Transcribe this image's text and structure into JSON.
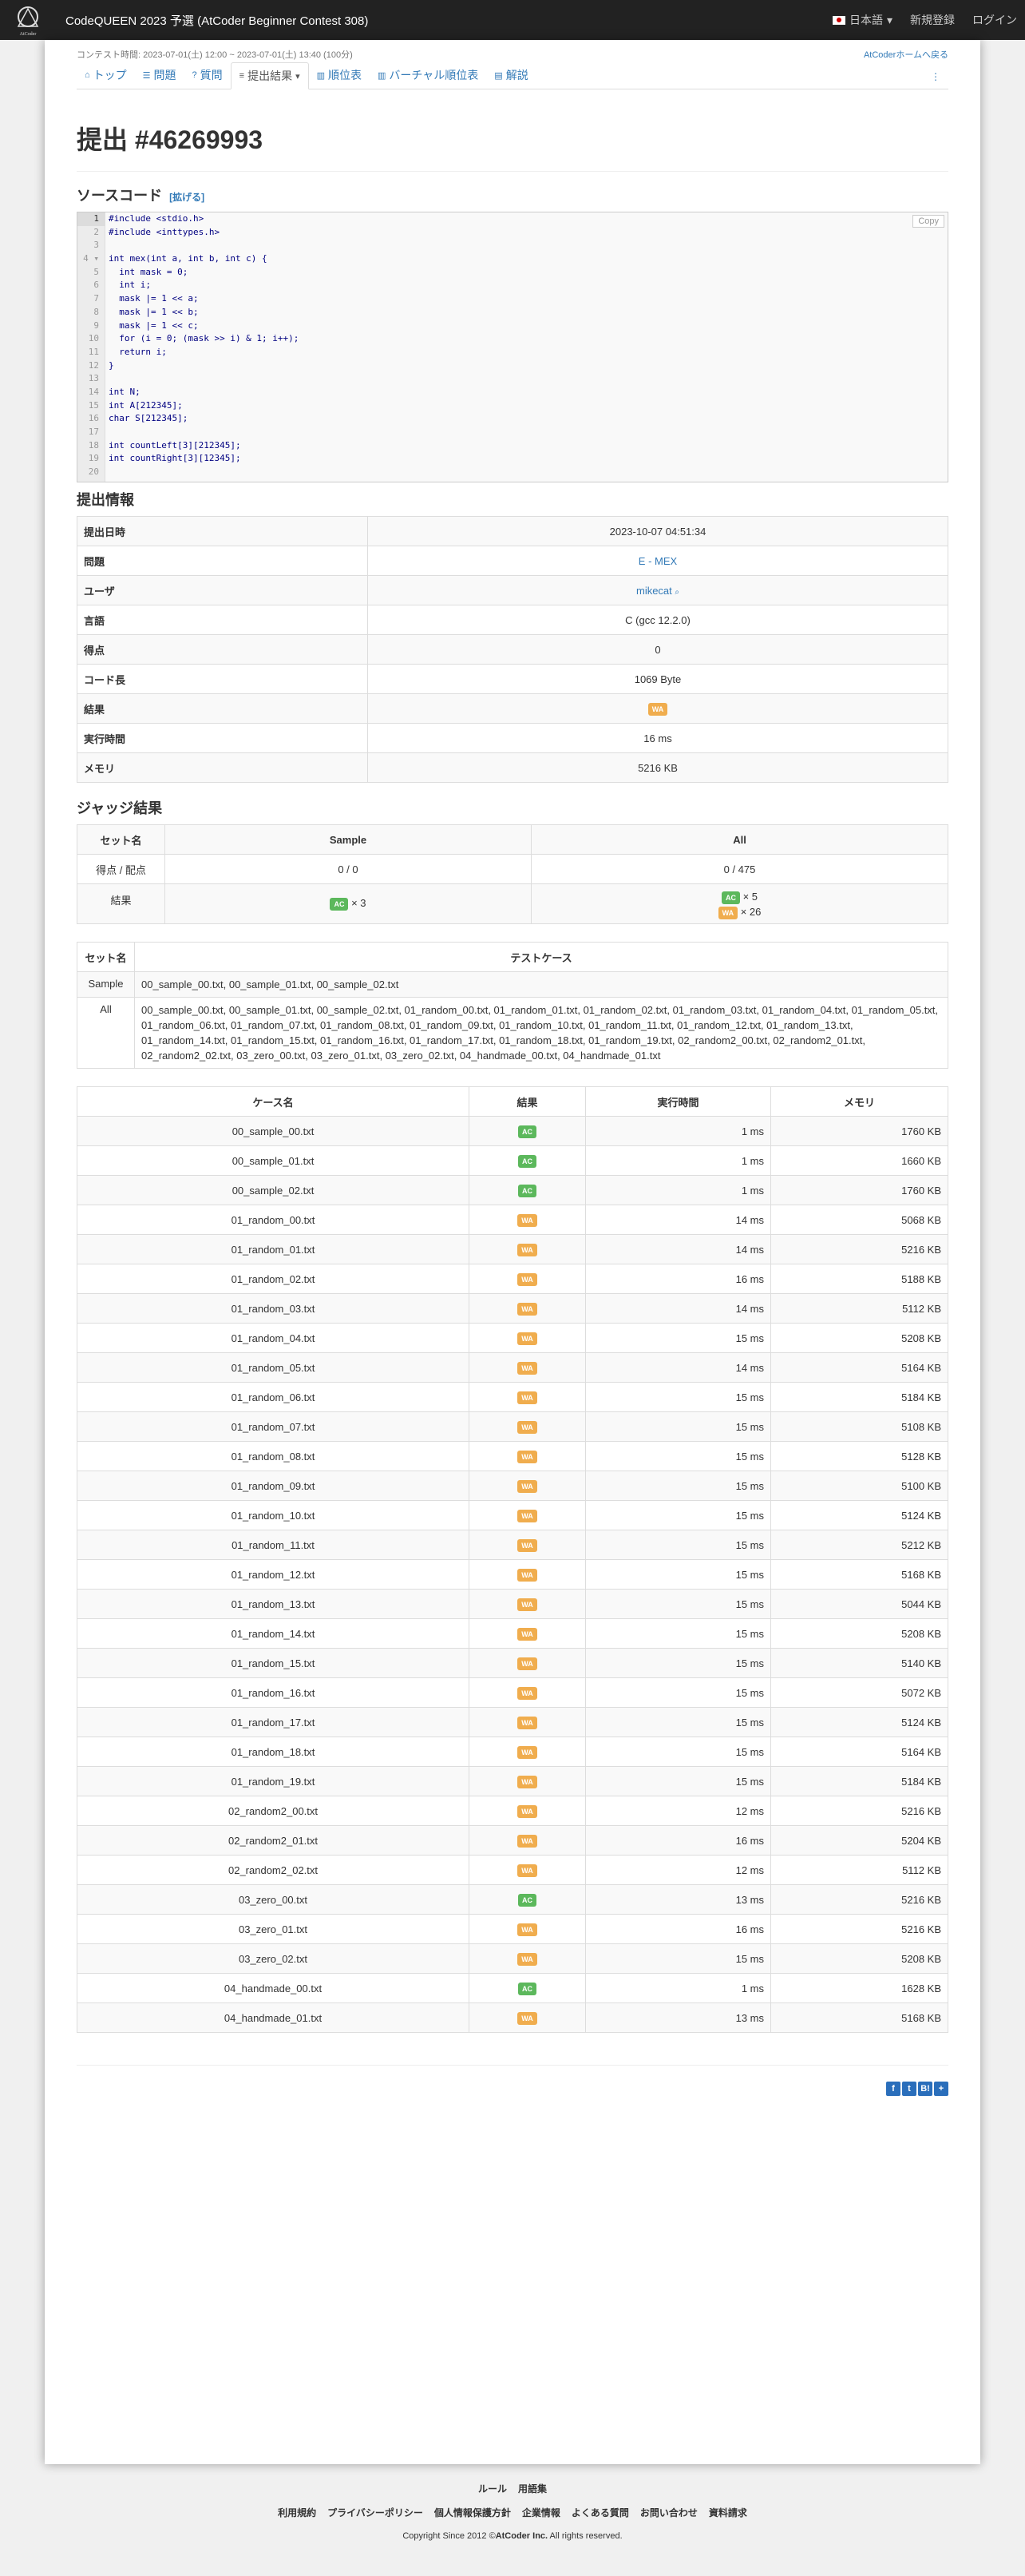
{
  "navbar": {
    "title": "CodeQUEEN 2023 予選 (AtCoder Beginner Contest 308)",
    "lang": "日本語",
    "signup": "新規登録",
    "login": "ログイン",
    "logo_text": "AtCoder"
  },
  "contest_bar": {
    "time": "コンテスト時間: 2023-07-01(土) 12:00 ~ 2023-07-01(土) 13:40 (100分)",
    "home_link": "AtCoderホームへ戻る"
  },
  "tabs": [
    {
      "label": "トップ"
    },
    {
      "label": "問題"
    },
    {
      "label": "質問"
    },
    {
      "label": "提出結果"
    },
    {
      "label": "順位表"
    },
    {
      "label": "バーチャル順位表"
    },
    {
      "label": "解説"
    }
  ],
  "submission": {
    "title": "提出 #46269993"
  },
  "source": {
    "heading": "ソースコード",
    "expand": "[拡げる]",
    "copy": "Copy",
    "lines": [
      "#include <stdio.h>",
      "#include <inttypes.h>",
      "",
      "int mex(int a, int b, int c) {",
      "  int mask = 0;",
      "  int i;",
      "  mask |= 1 << a;",
      "  mask |= 1 << b;",
      "  mask |= 1 << c;",
      "  for (i = 0; (mask >> i) & 1; i++);",
      "  return i;",
      "}",
      "",
      "int N;",
      "int A[212345];",
      "char S[212345];",
      "",
      "int countLeft[3][212345];",
      "int countRight[3][12345];",
      ""
    ]
  },
  "info": {
    "heading": "提出情報",
    "rows": [
      {
        "label": "提出日時",
        "value": "2023-10-07 04:51:34"
      },
      {
        "label": "問題",
        "value": "E - MEX"
      },
      {
        "label": "ユーザ",
        "value": "mikecat"
      },
      {
        "label": "言語",
        "value": "C (gcc 12.2.0)"
      },
      {
        "label": "得点",
        "value": "0"
      },
      {
        "label": "コード長",
        "value": "1069 Byte"
      },
      {
        "label": "結果",
        "value": "WA"
      },
      {
        "label": "実行時間",
        "value": "16 ms"
      },
      {
        "label": "メモリ",
        "value": "5216 KB"
      }
    ]
  },
  "judge": {
    "heading": "ジャッジ結果",
    "headers": [
      "セット名",
      "Sample",
      "All"
    ],
    "score_label": "得点 / 配点",
    "sample_score": "0 / 0",
    "all_score": "0 / 475",
    "result_label": "結果",
    "sample_ac": "AC",
    "sample_ac_count": "× 3",
    "all_ac": "AC",
    "all_ac_count": "× 5",
    "all_wa": "WA",
    "all_wa_count": "× 26"
  },
  "case_sets": {
    "headers": [
      "セット名",
      "テストケース"
    ],
    "rows": [
      {
        "name": "Sample",
        "cases": "00_sample_00.txt, 00_sample_01.txt, 00_sample_02.txt"
      },
      {
        "name": "All",
        "cases": "00_sample_00.txt, 00_sample_01.txt, 00_sample_02.txt, 01_random_00.txt, 01_random_01.txt, 01_random_02.txt, 01_random_03.txt, 01_random_04.txt, 01_random_05.txt, 01_random_06.txt, 01_random_07.txt, 01_random_08.txt, 01_random_09.txt, 01_random_10.txt, 01_random_11.txt, 01_random_12.txt, 01_random_13.txt, 01_random_14.txt, 01_random_15.txt, 01_random_16.txt, 01_random_17.txt, 01_random_18.txt, 01_random_19.txt, 02_random2_00.txt, 02_random2_01.txt, 02_random2_02.txt, 03_zero_00.txt, 03_zero_01.txt, 03_zero_02.txt, 04_handmade_00.txt, 04_handmade_01.txt"
      }
    ]
  },
  "cases": {
    "headers": [
      "ケース名",
      "結果",
      "実行時間",
      "メモリ"
    ],
    "rows": [
      {
        "name": "00_sample_00.txt",
        "result": "AC",
        "time": "1 ms",
        "memory": "1760 KB"
      },
      {
        "name": "00_sample_01.txt",
        "result": "AC",
        "time": "1 ms",
        "memory": "1660 KB"
      },
      {
        "name": "00_sample_02.txt",
        "result": "AC",
        "time": "1 ms",
        "memory": "1760 KB"
      },
      {
        "name": "01_random_00.txt",
        "result": "WA",
        "time": "14 ms",
        "memory": "5068 KB"
      },
      {
        "name": "01_random_01.txt",
        "result": "WA",
        "time": "14 ms",
        "memory": "5216 KB"
      },
      {
        "name": "01_random_02.txt",
        "result": "WA",
        "time": "16 ms",
        "memory": "5188 KB"
      },
      {
        "name": "01_random_03.txt",
        "result": "WA",
        "time": "14 ms",
        "memory": "5112 KB"
      },
      {
        "name": "01_random_04.txt",
        "result": "WA",
        "time": "15 ms",
        "memory": "5208 KB"
      },
      {
        "name": "01_random_05.txt",
        "result": "WA",
        "time": "14 ms",
        "memory": "5164 KB"
      },
      {
        "name": "01_random_06.txt",
        "result": "WA",
        "time": "15 ms",
        "memory": "5184 KB"
      },
      {
        "name": "01_random_07.txt",
        "result": "WA",
        "time": "15 ms",
        "memory": "5108 KB"
      },
      {
        "name": "01_random_08.txt",
        "result": "WA",
        "time": "15 ms",
        "memory": "5128 KB"
      },
      {
        "name": "01_random_09.txt",
        "result": "WA",
        "time": "15 ms",
        "memory": "5100 KB"
      },
      {
        "name": "01_random_10.txt",
        "result": "WA",
        "time": "15 ms",
        "memory": "5124 KB"
      },
      {
        "name": "01_random_11.txt",
        "result": "WA",
        "time": "15 ms",
        "memory": "5212 KB"
      },
      {
        "name": "01_random_12.txt",
        "result": "WA",
        "time": "15 ms",
        "memory": "5168 KB"
      },
      {
        "name": "01_random_13.txt",
        "result": "WA",
        "time": "15 ms",
        "memory": "5044 KB"
      },
      {
        "name": "01_random_14.txt",
        "result": "WA",
        "time": "15 ms",
        "memory": "5208 KB"
      },
      {
        "name": "01_random_15.txt",
        "result": "WA",
        "time": "15 ms",
        "memory": "5140 KB"
      },
      {
        "name": "01_random_16.txt",
        "result": "WA",
        "time": "15 ms",
        "memory": "5072 KB"
      },
      {
        "name": "01_random_17.txt",
        "result": "WA",
        "time": "15 ms",
        "memory": "5124 KB"
      },
      {
        "name": "01_random_18.txt",
        "result": "WA",
        "time": "15 ms",
        "memory": "5164 KB"
      },
      {
        "name": "01_random_19.txt",
        "result": "WA",
        "time": "15 ms",
        "memory": "5184 KB"
      },
      {
        "name": "02_random2_00.txt",
        "result": "WA",
        "time": "12 ms",
        "memory": "5216 KB"
      },
      {
        "name": "02_random2_01.txt",
        "result": "WA",
        "time": "16 ms",
        "memory": "5204 KB"
      },
      {
        "name": "02_random2_02.txt",
        "result": "WA",
        "time": "12 ms",
        "memory": "5112 KB"
      },
      {
        "name": "03_zero_00.txt",
        "result": "AC",
        "time": "13 ms",
        "memory": "5216 KB"
      },
      {
        "name": "03_zero_01.txt",
        "result": "WA",
        "time": "16 ms",
        "memory": "5216 KB"
      },
      {
        "name": "03_zero_02.txt",
        "result": "WA",
        "time": "15 ms",
        "memory": "5208 KB"
      },
      {
        "name": "04_handmade_00.txt",
        "result": "AC",
        "time": "1 ms",
        "memory": "1628 KB"
      },
      {
        "name": "04_handmade_01.txt",
        "result": "WA",
        "time": "13 ms",
        "memory": "5168 KB"
      }
    ]
  },
  "share": [
    "f",
    "t",
    "B!",
    "+"
  ],
  "footer": {
    "row1": [
      "ルール",
      "用語集"
    ],
    "row2": [
      "利用規約",
      "プライバシーポリシー",
      "個人情報保護方針",
      "企業情報",
      "よくある質問",
      "お問い合わせ",
      "資料請求"
    ],
    "copyright_prefix": "Copyright Since 2012 ©",
    "copyright_company": "AtCoder Inc.",
    "copyright_suffix": " All rights reserved."
  },
  "colors": {
    "ac": "#5cb85c",
    "wa": "#f0ad4e",
    "link": "#337ab7",
    "navbar": "#222222"
  }
}
